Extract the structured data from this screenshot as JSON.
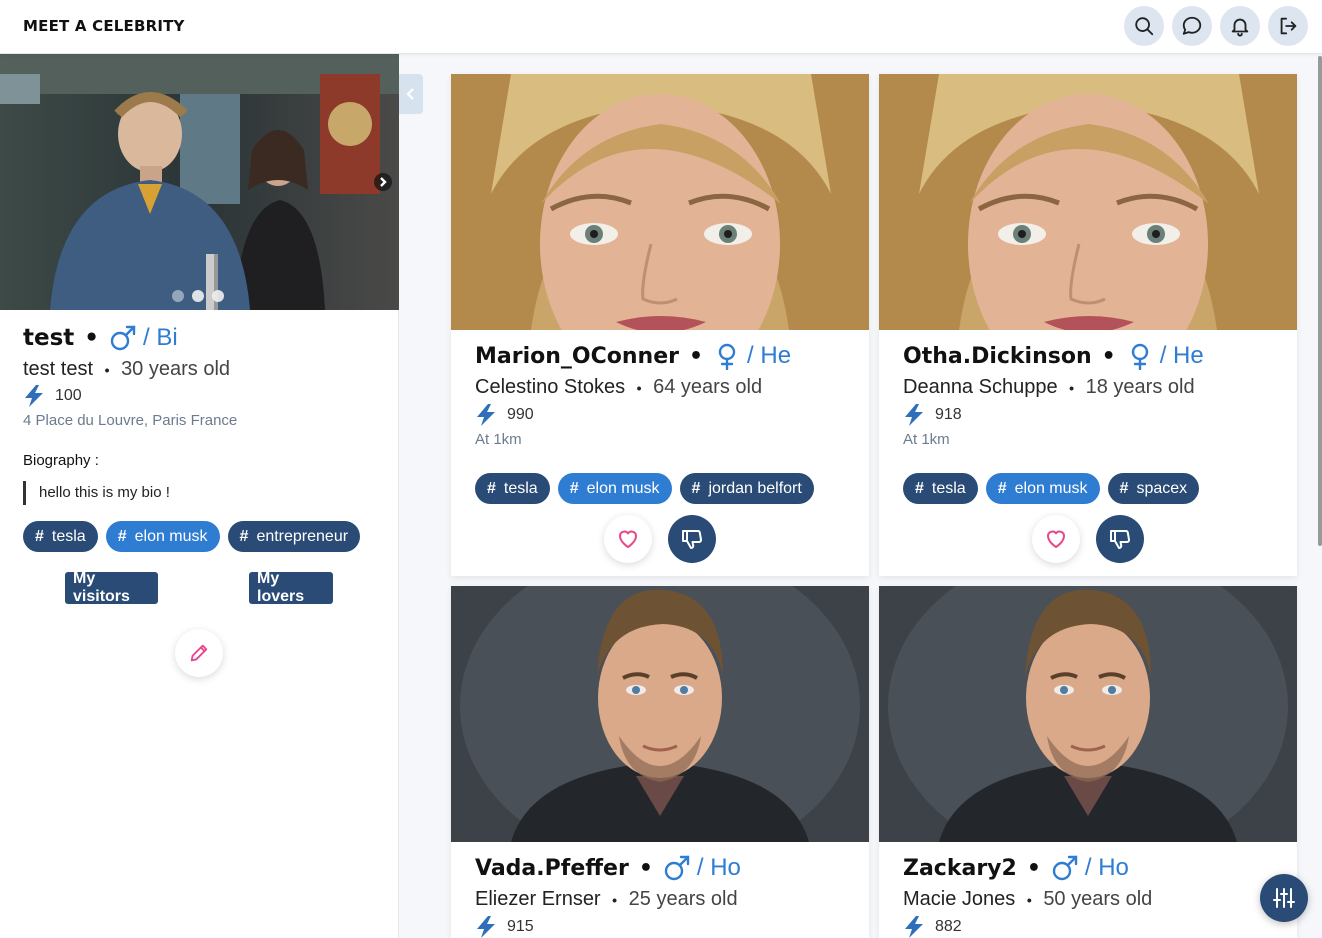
{
  "header": {
    "brand": "MEET A CELEBRITY",
    "icons": [
      "search-icon",
      "chat-icon",
      "bell-icon",
      "logout-icon"
    ]
  },
  "profile": {
    "username": "test",
    "orientation": "/ Bi",
    "gender_icon": "male-icon",
    "full_name": "test test",
    "age": "30 years old",
    "score": "100",
    "address": "4 Place du Louvre, Paris France",
    "bio_label": "Biography :",
    "bio": "hello this is my bio !",
    "tags": [
      "tesla",
      "elon musk",
      "entrepreneur"
    ],
    "visitors_label": "My visitors",
    "lovers_label": "My lovers",
    "photo_count": 3,
    "active_photo": 2
  },
  "cards": [
    {
      "username": "Marion_OConner",
      "orientation": "/ He",
      "gender_icon": "female-icon",
      "full_name": "Celestino Stokes",
      "age": "64 years old",
      "score": "990",
      "distance": "At 1km",
      "tags": [
        "tesla",
        "elon musk",
        "jordan belfort"
      ]
    },
    {
      "username": "Otha.Dickinson",
      "orientation": "/ He",
      "gender_icon": "female-icon",
      "full_name": "Deanna Schuppe",
      "age": "18 years old",
      "score": "918",
      "distance": "At 1km",
      "tags": [
        "tesla",
        "elon musk",
        "spacex"
      ]
    },
    {
      "username": "Vada.Pfeffer",
      "orientation": "/ Ho",
      "gender_icon": "male-icon",
      "full_name": "Eliezer Ernser",
      "age": "25 years old",
      "score": "915"
    },
    {
      "username": "Zackary2",
      "orientation": "/ Ho",
      "gender_icon": "male-icon",
      "full_name": "Macie Jones",
      "age": "50 years old",
      "score": "882"
    }
  ],
  "colors": {
    "accent_blue": "#2f7dd3",
    "navy": "#294b75",
    "pink": "#e8478b"
  }
}
